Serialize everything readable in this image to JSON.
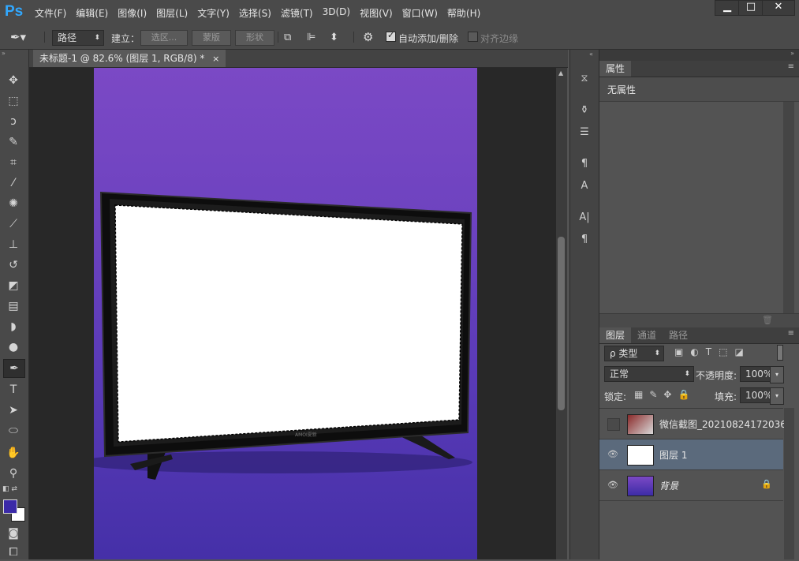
{
  "app": {
    "logo": "Ps"
  },
  "menu": [
    "文件(F)",
    "编辑(E)",
    "图像(I)",
    "图层(L)",
    "文字(Y)",
    "选择(S)",
    "滤镜(T)",
    "3D(D)",
    "视图(V)",
    "窗口(W)",
    "帮助(H)"
  ],
  "window_controls": {
    "minimize": "▁",
    "maximize": "□",
    "close": "✕"
  },
  "options": {
    "tool_mode": "路径",
    "build_label": "建立：",
    "selection_btn": "选区...",
    "mask_btn": "蒙版",
    "shape_btn": "形状",
    "auto_add_delete": "自动添加/删除",
    "align_edges": "对齐边缘"
  },
  "document": {
    "tab_title": "未标题-1 @ 82.6% (图层 1, RGB/8) *",
    "tab_close": "×",
    "tv_brand": "AMOI夏新"
  },
  "properties": {
    "tab": "属性",
    "content": "无属性"
  },
  "layers_panel": {
    "tabs": [
      "图层",
      "通道",
      "路径"
    ],
    "filter_kind": "ρ 类型",
    "blend_mode": "正常",
    "opacity_label": "不透明度:",
    "opacity_value": "100%",
    "lock_label": "锁定:",
    "fill_label": "填充:",
    "fill_value": "100%",
    "layers": [
      {
        "name": "微信截图_20210824172036",
        "visible": false,
        "selected": false
      },
      {
        "name": "图层 1",
        "visible": true,
        "selected": true
      },
      {
        "name": "背景",
        "visible": true,
        "selected": false,
        "locked": true
      }
    ]
  },
  "colors": {
    "foreground": "#3b2aa8",
    "background": "#ffffff",
    "accent": "#31a8ff"
  }
}
